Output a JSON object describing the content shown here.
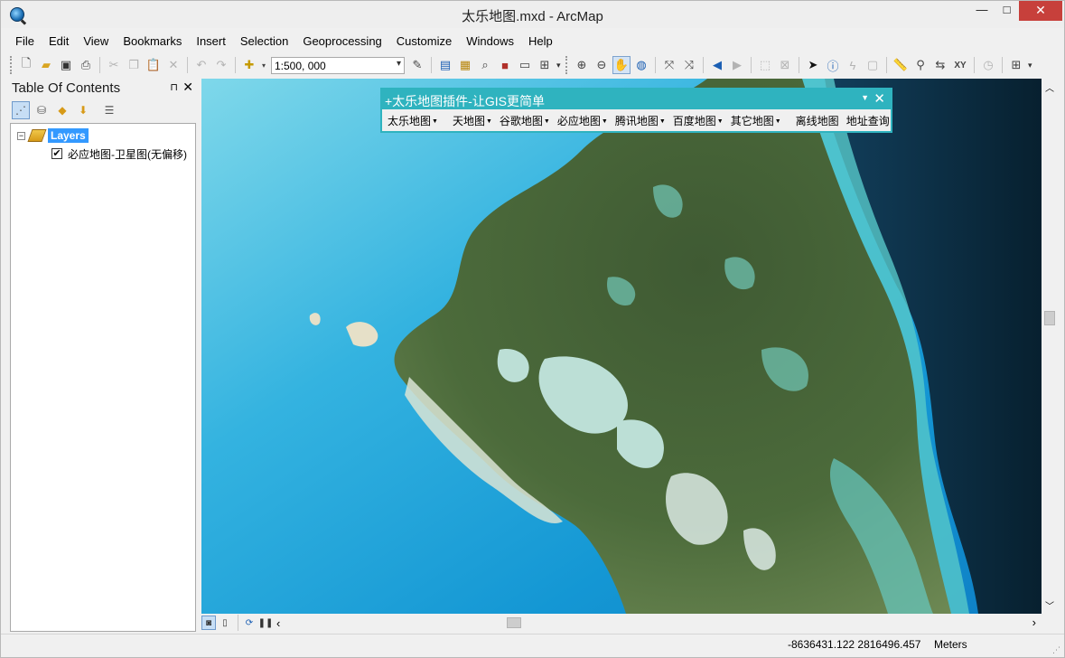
{
  "window": {
    "title": "太乐地图.mxd - ArcMap",
    "minimize_glyph": "—",
    "maximize_glyph": "□",
    "close_glyph": "✕"
  },
  "menu": [
    "File",
    "Edit",
    "View",
    "Bookmarks",
    "Insert",
    "Selection",
    "Geoprocessing",
    "Customize",
    "Windows",
    "Help"
  ],
  "toolbar": {
    "scale": "1:500, 000",
    "icons": [
      "new-document-icon",
      "open-folder-icon",
      "save-icon",
      "print-icon",
      "cut-icon",
      "copy-icon",
      "paste-icon",
      "delete-icon",
      "undo-icon",
      "redo-icon",
      "add-data-icon",
      "editor-icon",
      "table-of-contents-icon",
      "catalog-icon",
      "search-window-icon",
      "arctoolbox-icon",
      "python-window-icon",
      "model-builder-icon",
      "zoom-in-icon",
      "zoom-out-icon",
      "pan-icon",
      "full-extent-icon",
      "fixed-zoom-in-icon",
      "fixed-zoom-out-icon",
      "back-extent-icon",
      "forward-extent-icon",
      "select-features-icon",
      "clear-selection-icon",
      "select-elements-icon",
      "identify-icon",
      "hyperlink-icon",
      "html-popup-icon",
      "measure-icon",
      "find-icon",
      "find-route-icon",
      "go-to-xy-icon",
      "time-slider-icon",
      "magnifier-icon"
    ]
  },
  "toc": {
    "title": "Table Of Contents",
    "pin_glyph": "⊓",
    "close_glyph": "✕",
    "root_label": "Layers",
    "layer_name": "必应地图-卫星图(无偏移)",
    "layer_checked": true
  },
  "plugin": {
    "title": "+太乐地图插件-让GIS更简单",
    "close_glyph": "✕",
    "menus": [
      "太乐地图",
      "天地图",
      "谷歌地图",
      "必应地图",
      "腾讯地图",
      "百度地图",
      "其它地图"
    ],
    "buttons": [
      "离线地图",
      "地址查询"
    ]
  },
  "status": {
    "coordinates": "-8636431.122  2816496.457",
    "units": "Meters"
  },
  "colors": {
    "accent": "#3399ff",
    "plugin_frame": "#2fb3bf",
    "close_red": "#c7403b"
  }
}
